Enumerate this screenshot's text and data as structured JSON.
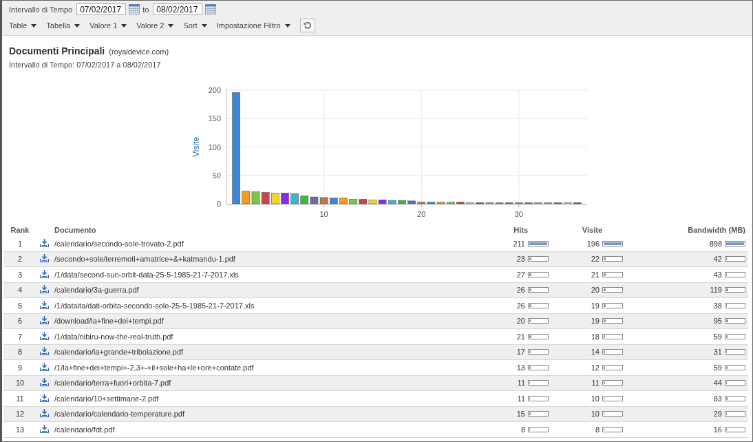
{
  "filter": {
    "label": "Intervallo di Tempo",
    "from": "07/02/2017",
    "to_label": "to",
    "to": "08/02/2017"
  },
  "menus": [
    "Table",
    "Tabella",
    "Valore 1",
    "Valore 2",
    "Sort",
    "Impostazione Filtro"
  ],
  "report": {
    "title": "Documenti Principali",
    "site": "(royaldevice.com)",
    "range": "Intervallo di Tempo:  07/02/2017 a 08/02/2017"
  },
  "chart_data": {
    "type": "bar",
    "ylabel": "Visite",
    "grid": true,
    "x": [
      1,
      2,
      3,
      4,
      5,
      6,
      7,
      8,
      9,
      10,
      11,
      12,
      13,
      14,
      15,
      16,
      17,
      18,
      19,
      20,
      21,
      22,
      23,
      24,
      25,
      26,
      27,
      28,
      29,
      30,
      31,
      32,
      33,
      34,
      35,
      36
    ],
    "values": [
      196,
      22,
      21,
      20,
      19,
      19,
      18,
      14,
      12,
      11,
      10,
      10,
      8,
      8,
      7,
      7,
      6,
      6,
      5,
      3,
      3,
      3,
      3,
      3,
      2,
      2,
      2,
      2,
      2,
      2,
      2,
      2,
      2,
      2,
      2,
      2
    ],
    "xlim": [
      0,
      37
    ],
    "ylim": [
      0,
      200
    ],
    "xticks": [
      10,
      20,
      30
    ],
    "yticks": [
      0,
      50,
      100,
      150,
      200
    ]
  },
  "table": {
    "columns": [
      "Rank",
      "Documento",
      "Hits",
      "Visite",
      "Bandwidth (MB)"
    ],
    "rows": [
      {
        "rank": "1",
        "document": "/calendario/secondo-sole-trovato-2.pdf",
        "hits": {
          "value": "211",
          "level": 1
        },
        "visits": {
          "value": "196",
          "level": 1
        },
        "bandwidth": {
          "value": "898",
          "level": 1
        }
      },
      {
        "rank": "2",
        "document": "/secondo+sole/terremoti+amatrice+&+katmandu-1.pdf",
        "hits": {
          "value": "23",
          "level": 0.11
        },
        "visits": {
          "value": "22",
          "level": 0.11
        },
        "bandwidth": {
          "value": "42",
          "level": 0.05
        }
      },
      {
        "rank": "3",
        "document": "/1/data/second-sun-orbit-data-25-5-1985-21-7-2017.xls",
        "hits": {
          "value": "27",
          "level": 0.13
        },
        "visits": {
          "value": "21",
          "level": 0.11
        },
        "bandwidth": {
          "value": "43",
          "level": 0.05
        }
      },
      {
        "rank": "4",
        "document": "/calendario/3a-guerra.pdf",
        "hits": {
          "value": "26",
          "level": 0.12
        },
        "visits": {
          "value": "20",
          "level": 0.1
        },
        "bandwidth": {
          "value": "119",
          "level": 0.13
        }
      },
      {
        "rank": "5",
        "document": "/1/dataita/dati-orbita-secondo-sole-25-5-1985-21-7-2017.xls",
        "hits": {
          "value": "26",
          "level": 0.12
        },
        "visits": {
          "value": "19",
          "level": 0.1
        },
        "bandwidth": {
          "value": "38",
          "level": 0.04
        }
      },
      {
        "rank": "6",
        "document": "/download/la+fine+dei+tempi.pdf",
        "hits": {
          "value": "20",
          "level": 0.09
        },
        "visits": {
          "value": "19",
          "level": 0.1
        },
        "bandwidth": {
          "value": "95",
          "level": 0.11
        }
      },
      {
        "rank": "7",
        "document": "/1/data/nibiru-now-the-real-truth.pdf",
        "hits": {
          "value": "21",
          "level": 0.1
        },
        "visits": {
          "value": "18",
          "level": 0.09
        },
        "bandwidth": {
          "value": "59",
          "level": 0.07
        }
      },
      {
        "rank": "8",
        "document": "/calendario/la+grande+tribolazione.pdf",
        "hits": {
          "value": "17",
          "level": 0.08
        },
        "visits": {
          "value": "14",
          "level": 0.07
        },
        "bandwidth": {
          "value": "31",
          "level": 0.03
        }
      },
      {
        "rank": "9",
        "document": "/1/la+fine+dei+tempi+-2.3+-+il+sole+ha+le+ore+contate.pdf",
        "hits": {
          "value": "13",
          "level": 0.06
        },
        "visits": {
          "value": "12",
          "level": 0.06
        },
        "bandwidth": {
          "value": "59",
          "level": 0.07
        }
      },
      {
        "rank": "10",
        "document": "/calendario/terra+fuori+orbita-7.pdf",
        "hits": {
          "value": "11",
          "level": 0.05
        },
        "visits": {
          "value": "11",
          "level": 0.06
        },
        "bandwidth": {
          "value": "44",
          "level": 0.05
        }
      },
      {
        "rank": "11",
        "document": "/calendario/10+settimane-2.pdf",
        "hits": {
          "value": "11",
          "level": 0.05
        },
        "visits": {
          "value": "10",
          "level": 0.05
        },
        "bandwidth": {
          "value": "83",
          "level": 0.09
        }
      },
      {
        "rank": "12",
        "document": "/calendario/calendario-temperature.pdf",
        "hits": {
          "value": "15",
          "level": 0.07
        },
        "visits": {
          "value": "10",
          "level": 0.05
        },
        "bandwidth": {
          "value": "29",
          "level": 0.03
        }
      },
      {
        "rank": "13",
        "document": "/calendario/fdt.pdf",
        "hits": {
          "value": "8",
          "level": 0.04
        },
        "visits": {
          "value": "8",
          "level": 0.04
        },
        "bandwidth": {
          "value": "16",
          "level": 0.02
        }
      }
    ]
  }
}
